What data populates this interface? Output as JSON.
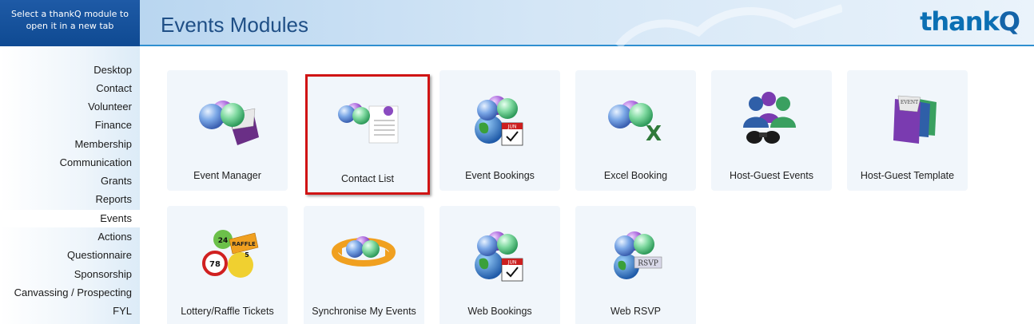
{
  "header": {
    "module_select": "Select a thankQ module to open it in a new tab",
    "page_title": "Events Modules",
    "logo_text": "thank",
    "logo_q": "Q"
  },
  "sidebar": {
    "items": [
      {
        "label": "Desktop"
      },
      {
        "label": "Contact"
      },
      {
        "label": "Volunteer"
      },
      {
        "label": "Finance"
      },
      {
        "label": "Membership"
      },
      {
        "label": "Communication"
      },
      {
        "label": "Grants"
      },
      {
        "label": "Reports"
      },
      {
        "label": "Events",
        "active": true
      },
      {
        "label": "Actions"
      },
      {
        "label": "Questionnaire"
      },
      {
        "label": "Sponsorship"
      },
      {
        "label": "Canvassing / Prospecting"
      },
      {
        "label": "FYL"
      }
    ]
  },
  "tiles": [
    {
      "label": "Event Manager",
      "icon": "balloons-envelope-icon"
    },
    {
      "label": "Contact List",
      "icon": "balloons-contact-list-icon",
      "highlighted": true
    },
    {
      "label": "Event Bookings",
      "icon": "balloons-globe-calendar-icon",
      "badge": "JUN"
    },
    {
      "label": "Excel Booking",
      "icon": "balloons-excel-icon"
    },
    {
      "label": "Host-Guest Events",
      "icon": "people-binoculars-icon"
    },
    {
      "label": "Host-Guest Template",
      "icon": "event-folders-icon",
      "badge": "EVENT"
    },
    {
      "label": "Lottery/Raffle Tickets",
      "icon": "lottery-balls-icon",
      "badge": "RAFFLE"
    },
    {
      "label": "Synchronise My Events",
      "icon": "balloons-sync-icon"
    },
    {
      "label": "Web Bookings",
      "icon": "balloons-globe-calendar-icon",
      "badge": "JUN"
    },
    {
      "label": "Web RSVP",
      "icon": "balloons-globe-rsvp-icon",
      "badge": "RSVP"
    }
  ],
  "colors": {
    "accent": "#2f8fd0",
    "header_dark": "#0f4a92",
    "highlight": "#d01414"
  }
}
